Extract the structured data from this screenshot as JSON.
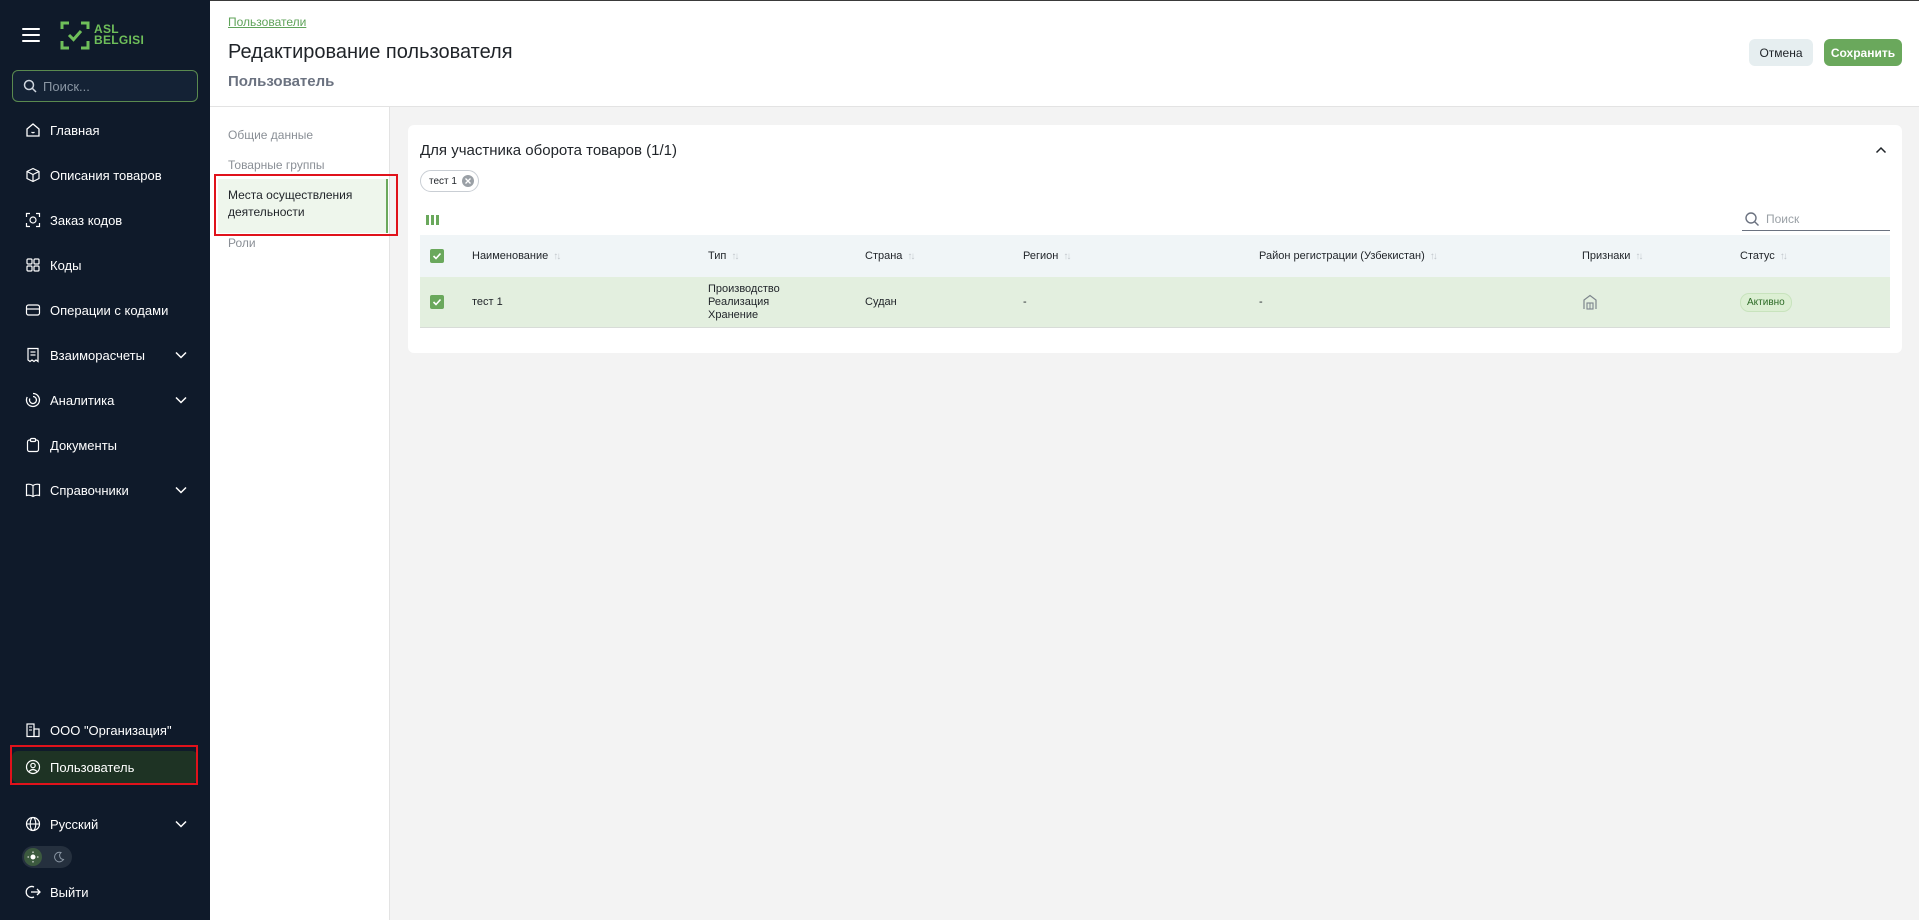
{
  "brand": {
    "logo_line1": "ASL",
    "logo_line2": "BELGISI"
  },
  "sidebar": {
    "search_placeholder": "Поиск...",
    "items": [
      {
        "label": "Главная",
        "icon": "home-icon"
      },
      {
        "label": "Описания товаров",
        "icon": "cube-icon"
      },
      {
        "label": "Заказ кодов",
        "icon": "scan-icon"
      },
      {
        "label": "Коды",
        "icon": "qr-icon"
      },
      {
        "label": "Операции с кодами",
        "icon": "operations-icon"
      },
      {
        "label": "Взаиморасчеты",
        "icon": "receipt-icon"
      },
      {
        "label": "Аналитика",
        "icon": "analytics-icon"
      },
      {
        "label": "Документы",
        "icon": "clipboard-icon"
      },
      {
        "label": "Справочники",
        "icon": "book-icon"
      }
    ],
    "org": "ООО \"Организация\"",
    "user": "Пользователь",
    "language": "Русский",
    "logout": "Выйти"
  },
  "header": {
    "breadcrumb": "Пользователи",
    "title": "Редактирование пользователя",
    "subtitle": "Пользователь",
    "cancel_label": "Отмена",
    "save_label": "Сохранить"
  },
  "tabs": {
    "general": "Общие данные",
    "product_groups": "Товарные группы",
    "places": "Места осуществления деятельности",
    "roles": "Роли"
  },
  "card": {
    "title": "Для участника оборота товаров (1/1)",
    "chip": "тест 1",
    "search_placeholder": "Поиск",
    "columns": [
      "Наименование",
      "Тип",
      "Страна",
      "Регион",
      "Район регистрации (Узбекистан)",
      "Признаки",
      "Статус"
    ],
    "rows": [
      {
        "name": "тест 1",
        "type_lines": [
          "Производство",
          "Реализация",
          "Хранение"
        ],
        "country": "Судан",
        "region": "-",
        "district": "-",
        "sign_icon": "building-icon",
        "status": "Активно"
      }
    ]
  },
  "colors": {
    "accent": "#6aa85c",
    "sidebar_bg": "#0f1a2a",
    "highlight": "#e0121b"
  }
}
